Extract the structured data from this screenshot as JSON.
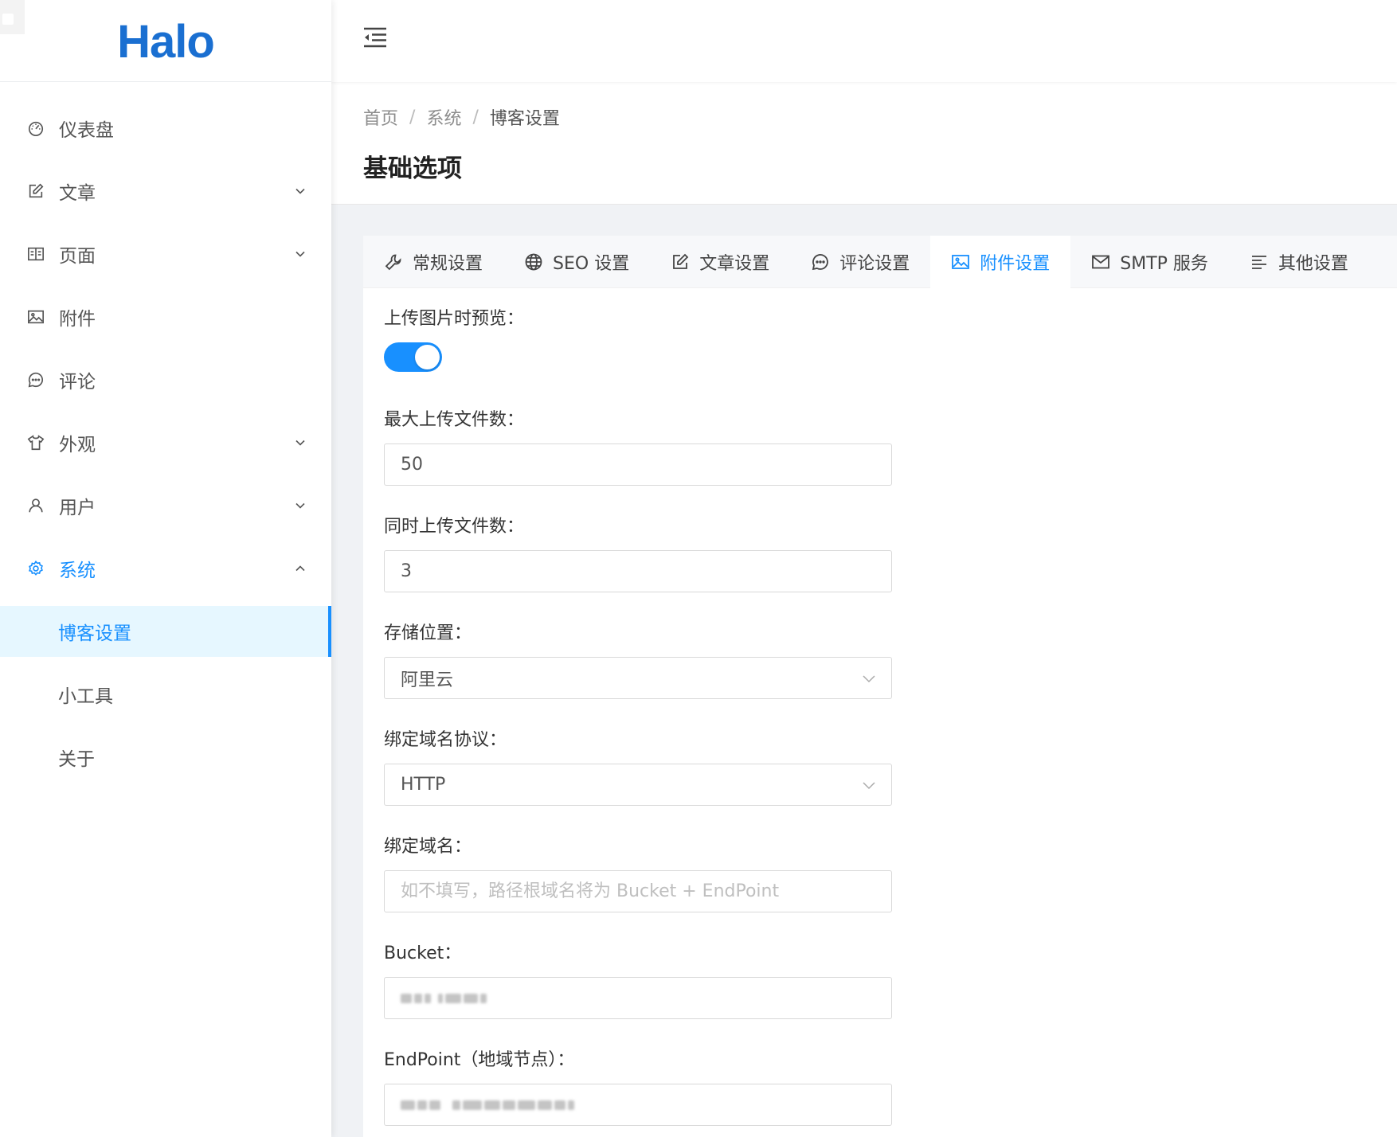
{
  "app": {
    "logo_text": "Halo",
    "brand_color": "#1890ff"
  },
  "sidebar": {
    "items": [
      {
        "label": "仪表盘",
        "icon": "dashboard-icon",
        "has_children": false
      },
      {
        "label": "文章",
        "icon": "edit-icon",
        "has_children": true
      },
      {
        "label": "页面",
        "icon": "book-icon",
        "has_children": true
      },
      {
        "label": "附件",
        "icon": "picture-icon",
        "has_children": false
      },
      {
        "label": "评论",
        "icon": "message-icon",
        "has_children": false
      },
      {
        "label": "外观",
        "icon": "skin-icon",
        "has_children": true
      },
      {
        "label": "用户",
        "icon": "user-icon",
        "has_children": true
      },
      {
        "label": "系统",
        "icon": "setting-icon",
        "has_children": true,
        "expanded": true
      }
    ],
    "sub_items": [
      {
        "label": "博客设置",
        "selected": true
      },
      {
        "label": "小工具",
        "selected": false
      },
      {
        "label": "关于",
        "selected": false
      }
    ]
  },
  "breadcrumb": [
    "首页",
    "系统",
    "博客设置"
  ],
  "page_title": "基础选项",
  "tabs": [
    {
      "label": "常规设置",
      "icon": "tool-icon"
    },
    {
      "label": "SEO 设置",
      "icon": "global-icon"
    },
    {
      "label": "文章设置",
      "icon": "form-icon"
    },
    {
      "label": "评论设置",
      "icon": "message-icon"
    },
    {
      "label": "附件设置",
      "icon": "picture-icon",
      "active": true
    },
    {
      "label": "SMTP 服务",
      "icon": "mail-icon"
    },
    {
      "label": "其他设置",
      "icon": "align-left-icon"
    }
  ],
  "form": {
    "preview_label": "上传图片时预览：",
    "preview_enabled": true,
    "max_files_label": "最大上传文件数：",
    "max_files_value": "50",
    "concurrent_label": "同时上传文件数：",
    "concurrent_value": "3",
    "storage_label": "存储位置：",
    "storage_value": "阿里云",
    "protocol_label": "绑定域名协议：",
    "protocol_value": "HTTP",
    "domain_label": "绑定域名：",
    "domain_placeholder": "如不填写，路径根域名将为 Bucket + EndPoint",
    "bucket_label": "Bucket：",
    "endpoint_label": "EndPoint（地域节点）："
  }
}
